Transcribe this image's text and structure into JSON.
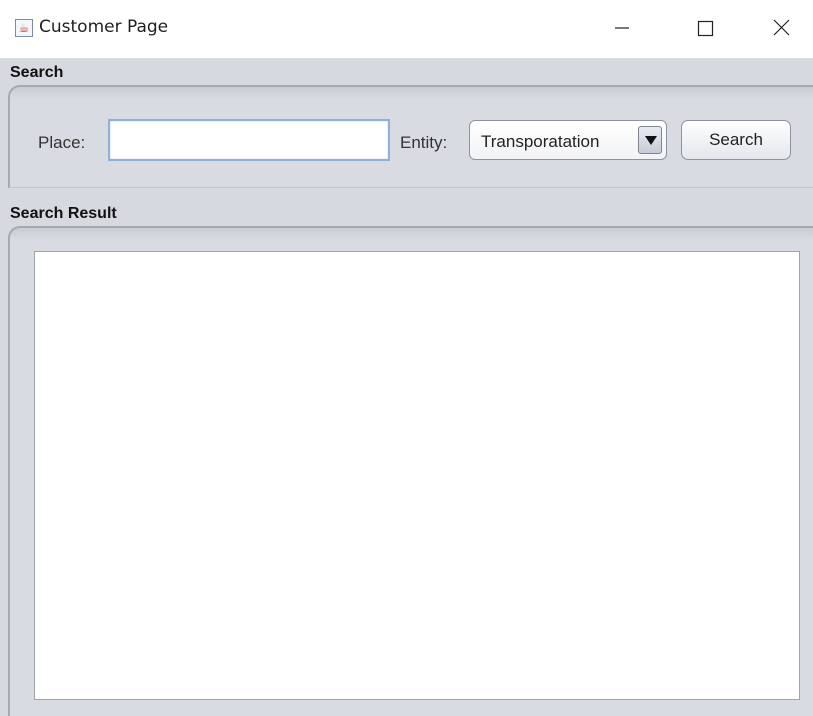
{
  "window": {
    "title": "Customer Page",
    "icon": "java-cup-icon",
    "controls": [
      "minimize-icon",
      "maximize-icon",
      "close-icon"
    ]
  },
  "search_section": {
    "title": "Search",
    "place_label": "Place:",
    "place_value": "",
    "entity_label": "Entity:",
    "entity_selected": "Transporatation",
    "search_button": "Search"
  },
  "result_section": {
    "title": "Search Result",
    "content": ""
  },
  "colors": {
    "panel_background": "#d6d9df",
    "input_focus_border": "#8fb1d8"
  }
}
